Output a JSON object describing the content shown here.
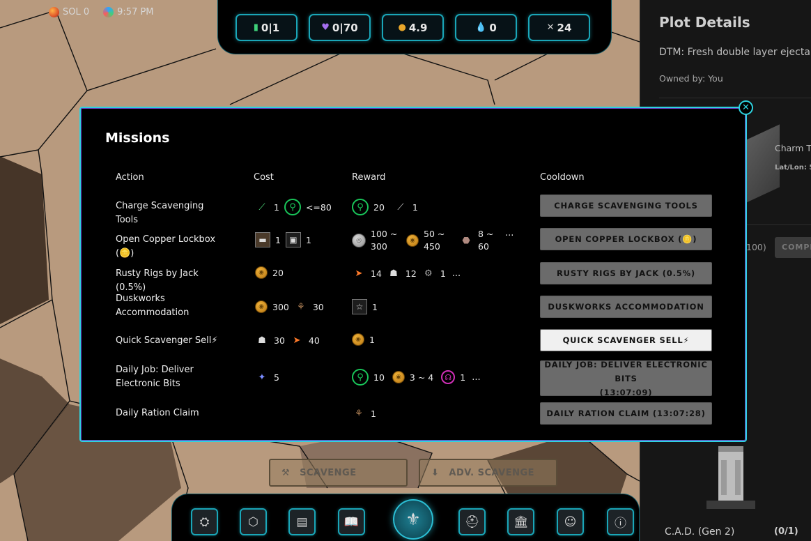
{
  "status": {
    "sol": "SOL 0",
    "time": "9:57 PM"
  },
  "resources": [
    {
      "icon": "battery-icon",
      "glyph": "▮",
      "value": "0|1"
    },
    {
      "icon": "heart-icon",
      "glyph": "♥",
      "value": "0|70"
    },
    {
      "icon": "coin-icon",
      "glyph": "●",
      "value": "4.9"
    },
    {
      "icon": "water-drop-icon",
      "glyph": "💧",
      "value": "0"
    },
    {
      "icon": "tools-icon",
      "glyph": "✕",
      "value": "24"
    }
  ],
  "panel": {
    "title": "Plot Details",
    "dtm": "DTM: Fresh double layer ejecta cr",
    "owned": "Owned by: You",
    "charm": "Charm Tr",
    "latlon": "Lat/Lon: 5",
    "count_partial": "100)",
    "complete_partial": "COMPL",
    "cad_label": "C.A.D. (Gen 2)",
    "cad_count": "(0/1)"
  },
  "modal": {
    "title": "Missions",
    "headers": {
      "action": "Action",
      "cost": "Cost",
      "reward": "Reward",
      "cooldown": "Cooldown"
    },
    "close_glyph": "✕",
    "rows": [
      {
        "action": "Charge Scavenging Tools",
        "cost": [
          {
            "icon": "battery-stick-icon",
            "value": "1"
          },
          {
            "icon": "scavenger-ring-icon",
            "value": "<=80"
          }
        ],
        "reward": [
          {
            "icon": "scavenger-ring-icon",
            "value": "20"
          },
          {
            "icon": "tool-stick-icon",
            "value": "1"
          }
        ],
        "button": "CHARGE SCAVENGING TOOLS"
      },
      {
        "action": "Open Copper Lockbox (🪙)",
        "cost": [
          {
            "icon": "lockbox-icon",
            "value": "1"
          },
          {
            "icon": "key-box-icon",
            "value": "1"
          }
        ],
        "reward": [
          {
            "icon": "silver-coin-icon",
            "value": "100 ~\n300"
          },
          {
            "icon": "gold-coin-icon",
            "value": "50 ~\n450"
          },
          {
            "icon": "ore-icon",
            "value": "8 ~\n60"
          }
        ],
        "reward_more": "...",
        "button": "OPEN COPPER LOCKBOX (🪙)"
      },
      {
        "action": "Rusty Rigs by Jack (0.5%)",
        "cost": [
          {
            "icon": "gold-coin-icon",
            "value": "20"
          }
        ],
        "reward": [
          {
            "icon": "scrap-fish-icon",
            "value": "14"
          },
          {
            "icon": "ghost-icon",
            "value": "12"
          },
          {
            "icon": "parts-icon",
            "value": "1"
          }
        ],
        "reward_more": "...",
        "button": "RUSTY RIGS BY JACK (0.5%)"
      },
      {
        "action": "Duskworks Accommodation",
        "cost": [
          {
            "icon": "gold-coin-icon",
            "value": "300"
          },
          {
            "icon": "ration-icon",
            "value": "30"
          }
        ],
        "reward": [
          {
            "icon": "star-box-icon",
            "value": "1"
          }
        ],
        "button": "DUSKWORKS ACCOMMODATION"
      },
      {
        "action": "Quick Scavenger Sell⚡",
        "cost": [
          {
            "icon": "ghost-icon",
            "value": "30"
          },
          {
            "icon": "scrap-fish-icon",
            "value": "40"
          }
        ],
        "reward": [
          {
            "icon": "gold-coin-icon",
            "value": "1"
          }
        ],
        "button": "QUICK SCAVENGER SELL⚡"
      },
      {
        "action": "Daily Job: Deliver Electronic Bits",
        "cost": [
          {
            "icon": "electronic-bits-icon",
            "value": "5"
          }
        ],
        "reward": [
          {
            "icon": "scavenger-ring-icon",
            "value": "10"
          },
          {
            "icon": "gold-coin-icon",
            "value": "3 ~ 4"
          },
          {
            "icon": "pink-token-icon",
            "value": "1"
          }
        ],
        "reward_more": "...",
        "button": "DAILY JOB: DELIVER ELECTRONIC BITS\n(13:07:09)"
      },
      {
        "action": "Daily Ration Claim",
        "cost": [],
        "reward": [
          {
            "icon": "ration-icon",
            "value": "1"
          }
        ],
        "button": "DAILY RATION CLAIM (13:07:28)"
      }
    ]
  },
  "scavenge": {
    "scavenge": "SCAVENGE",
    "adv_scavenge": "ADV. SCAVENGE"
  },
  "nav": [
    {
      "icon": "rig-icon",
      "glyph": "⛭"
    },
    {
      "icon": "hexagon-icon",
      "glyph": "⬡"
    },
    {
      "icon": "document-icon",
      "glyph": "▤"
    },
    {
      "icon": "book-icon",
      "glyph": "📖"
    },
    {
      "icon": "helmet-icon",
      "glyph": "⛑"
    },
    {
      "icon": "bank-icon",
      "glyph": "🏛"
    },
    {
      "icon": "discord-icon",
      "glyph": "☺"
    },
    {
      "icon": "info-icon",
      "glyph": "ⓘ"
    }
  ],
  "colors": {
    "accent": "#2ed3e0",
    "accent_purple": "#6b3fc8",
    "map_tan": "#b89a7e",
    "map_dark": "#463528",
    "button_gray": "#6b6b6b"
  }
}
